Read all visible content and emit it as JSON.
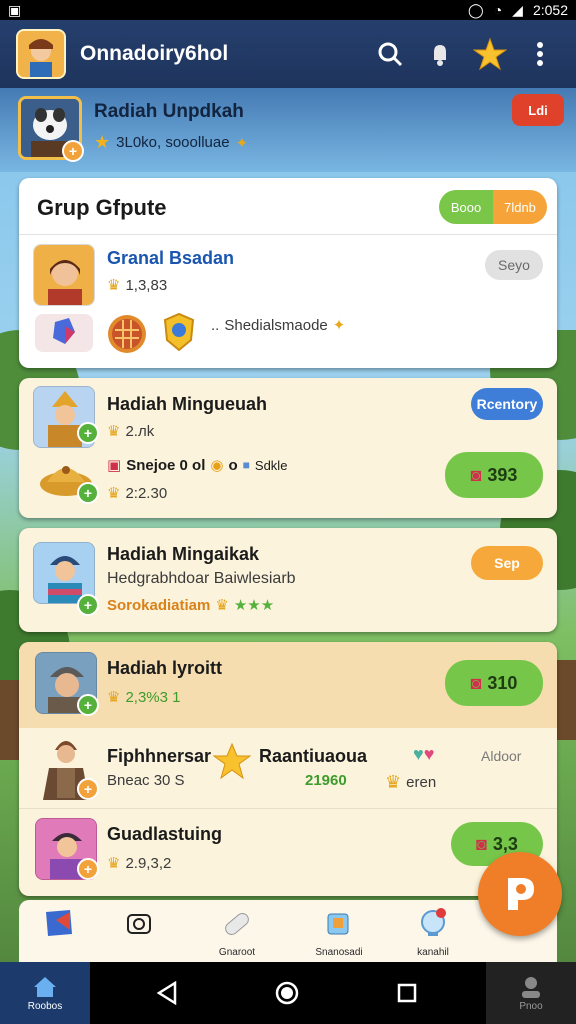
{
  "status_bar": {
    "time": "2:052"
  },
  "header": {
    "title": "Onnadoiry6hol"
  },
  "profile": {
    "name": "Radiah Unpdkah",
    "stat": "3L0ko, sooolluae",
    "badge": "Ldi"
  },
  "grup": {
    "title": "Grup Gfpute",
    "toggle_on": "Booo",
    "toggle_off": "7ldnb",
    "member": {
      "name": "Granal Bsadan",
      "stat": "1,3,83",
      "action": "Seyo",
      "note": "Shedialsmaode"
    }
  },
  "rows": [
    {
      "title": "Hadiah Mingueuah",
      "stat": "2.лk",
      "action": "Rcentory",
      "sub_title": "Snejoe 0 ol",
      "sub_extra": "o",
      "sub_tag": "Sdkle",
      "sub_stat": "2:2.30",
      "sub_value": "393"
    },
    {
      "title": "Hadiah Mingaikak",
      "desc": "Hedgrabhdoar Baiwlesiarb",
      "stat": "Sorokadiatiam",
      "action": "Sep"
    },
    {
      "title": "Hadiah lyroitt",
      "stat": "2,3%3 1",
      "value": "310"
    }
  ],
  "detail_row": {
    "title": "Fiphhnersar",
    "subtitle": "Bneac 30 S",
    "label": "Raantiuaoua",
    "value": "21960",
    "note": "Aldoor",
    "note_sub": "eren"
  },
  "last_row": {
    "title": "Guadlastuing",
    "stat": "2.9,3,2",
    "value": "3,3"
  },
  "tabs": [
    {
      "label": "",
      "icon": "book-icon"
    },
    {
      "label": "",
      "icon": "camera-icon"
    },
    {
      "label": "Gnaroot",
      "icon": "bandage-icon"
    },
    {
      "label": "Snanosadi",
      "icon": "mug-icon"
    },
    {
      "label": "kanahil",
      "icon": "orb-icon"
    }
  ],
  "nav": {
    "home_label": "Roobos",
    "right_label": "Pnoo"
  },
  "colors": {
    "header": "#253f6d",
    "accent_green": "#76c64a",
    "accent_orange": "#f6a93a",
    "accent_blue": "#3e7ed8",
    "fab": "#f07e28"
  }
}
